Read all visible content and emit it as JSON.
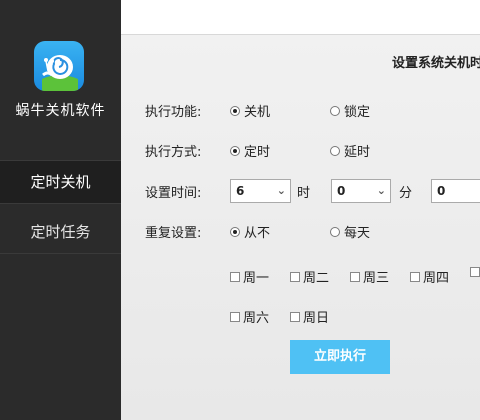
{
  "app": {
    "name": "蜗牛关机软件"
  },
  "nav": {
    "items": [
      {
        "label": "定时关机"
      },
      {
        "label": "定时任务"
      }
    ]
  },
  "form": {
    "title": "设置系统关机时",
    "function": {
      "label": "执行功能:",
      "options": [
        "关机",
        "锁定"
      ],
      "selected": "关机"
    },
    "mode": {
      "label": "执行方式:",
      "options": [
        "定时",
        "延时"
      ],
      "selected": "定时"
    },
    "time": {
      "label": "设置时间:",
      "hour": "6",
      "hour_unit": "时",
      "minute": "0",
      "minute_unit": "分",
      "second": "0"
    },
    "repeat": {
      "label": "重复设置:",
      "options": [
        "从不",
        "每天"
      ],
      "selected": "从不"
    },
    "weekdays": [
      "周一",
      "周二",
      "周三",
      "周四",
      "周六",
      "周日"
    ]
  },
  "action": {
    "execute_label": "立即执行"
  },
  "colors": {
    "sidebar": "#2b2b2b",
    "accent": "#4fc1f4"
  }
}
